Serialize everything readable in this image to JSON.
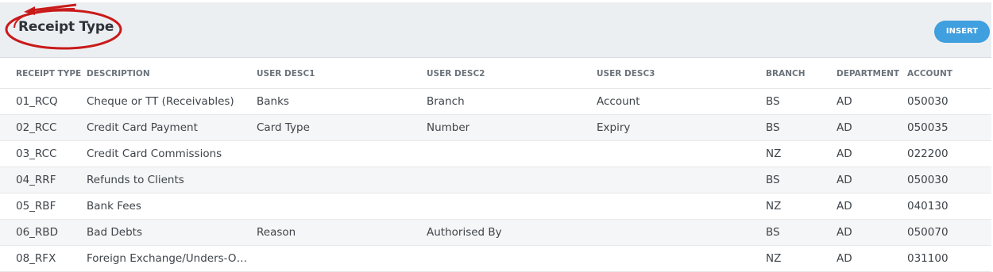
{
  "header": {
    "title": "Receipt Type",
    "insert_label": "INSERT",
    "accent_color": "#3f9fdf",
    "annotation_color": "#c91a1a"
  },
  "table": {
    "columns": [
      "RECEIPT TYPE",
      "DESCRIPTION",
      "USER DESC1",
      "USER DESC2",
      "USER DESC3",
      "BRANCH",
      "DEPARTMENT",
      "ACCOUNT"
    ],
    "rows": [
      [
        "01_RCQ",
        "Cheque or TT (Receivables)",
        "Banks",
        "Branch",
        "Account",
        "BS",
        "AD",
        "050030"
      ],
      [
        "02_RCC",
        "Credit Card Payment",
        "Card Type",
        "Number",
        "Expiry",
        "BS",
        "AD",
        "050035"
      ],
      [
        "03_RCC",
        "Credit Card Commissions",
        "",
        "",
        "",
        "NZ",
        "AD",
        "022200"
      ],
      [
        "04_RRF",
        "Refunds to Clients",
        "",
        "",
        "",
        "BS",
        "AD",
        "050030"
      ],
      [
        "05_RBF",
        "Bank Fees",
        "",
        "",
        "",
        "NZ",
        "AD",
        "040130"
      ],
      [
        "06_RBD",
        "Bad Debts",
        "Reason",
        "Authorised By",
        "",
        "BS",
        "AD",
        "050070"
      ],
      [
        "08_RFX",
        "Foreign Exchange/Unders-Ov…",
        "",
        "",
        "",
        "NZ",
        "AD",
        "031100"
      ]
    ]
  }
}
